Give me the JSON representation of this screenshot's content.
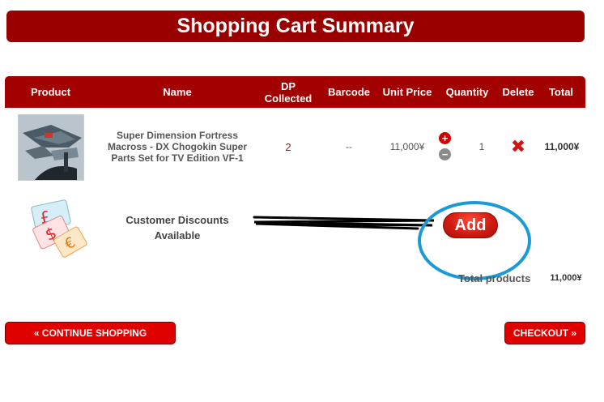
{
  "page": {
    "title": "Shopping Cart Summary"
  },
  "table": {
    "headers": [
      "Product",
      "Name",
      "DP Collected",
      "Barcode",
      "Unit Price",
      "Quantity",
      "Delete",
      "Total"
    ]
  },
  "item": {
    "name": "Super Dimension Fortress Macross - DX Chogokin Super Parts Set for TV Edition VF-1",
    "dp_collected": "2",
    "barcode": "--",
    "unit_price": "11,000¥",
    "quantity": "1",
    "total": "11,000¥",
    "increase_symbol": "+",
    "decrease_symbol": "−",
    "delete_symbol": "✖"
  },
  "discount": {
    "label": "Customer Discounts Available",
    "add_label": "Add"
  },
  "summary": {
    "total_products_label": "Total products",
    "total_products_value": "11,000¥"
  },
  "buttons": {
    "continue_label": "« CONTINUE SHOPPING",
    "checkout_label": "CHECKOUT »"
  },
  "colors": {
    "header_bg": "#a30000",
    "button_red": "#e00000",
    "annotation_circle": "#1a9ad6"
  }
}
